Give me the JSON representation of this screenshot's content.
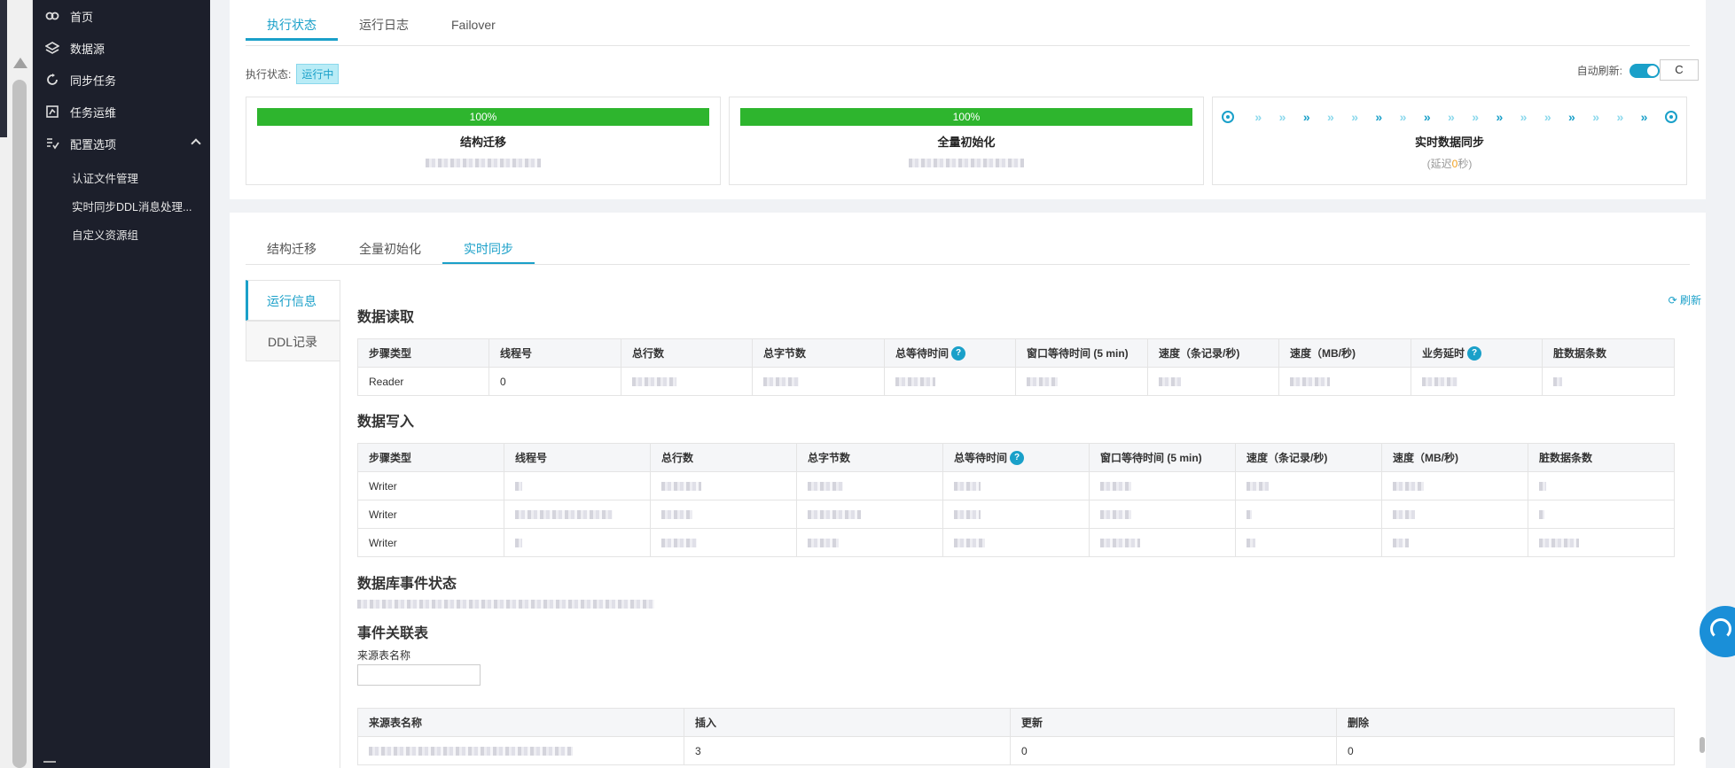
{
  "sidebar": {
    "items": [
      {
        "label": "首页",
        "icon": "home-icon"
      },
      {
        "label": "数据源",
        "icon": "layers-icon"
      },
      {
        "label": "同步任务",
        "icon": "sync-icon"
      },
      {
        "label": "任务运维",
        "icon": "ops-icon"
      },
      {
        "label": "配置选项",
        "icon": "config-icon"
      }
    ],
    "sub_items": [
      "认证文件管理",
      "实时同步DDL消息处理...",
      "自定义资源组"
    ]
  },
  "top_tabs": [
    "执行状态",
    "运行日志",
    "Failover"
  ],
  "status": {
    "label": "执行状态:",
    "value": "运行中"
  },
  "auto_refresh": {
    "label": "自动刷新:",
    "enabled": true,
    "button": "C"
  },
  "steps": [
    {
      "title": "结构迁移",
      "progress": "100%",
      "progress_value": 100
    },
    {
      "title": "全量初始化",
      "progress": "100%",
      "progress_value": 100
    },
    {
      "title": "实时数据同步",
      "delay_prefix": "(延迟",
      "delay_value": "0",
      "delay_suffix": "秒)"
    }
  ],
  "detail_tabs": [
    "结构迁移",
    "全量初始化",
    "实时同步"
  ],
  "side_tabs": [
    "运行信息",
    "DDL记录"
  ],
  "refresh_link": "刷新",
  "read_section": {
    "title": "数据读取",
    "headers": [
      "步骤类型",
      "线程号",
      "总行数",
      "总字节数",
      "总等待时间",
      "窗口等待时间 (5 min)",
      "速度（条记录/秒)",
      "速度（MB/秒)",
      "业务延时",
      "脏数据条数"
    ],
    "rows": [
      [
        "Reader",
        "0",
        "",
        "",
        "",
        "",
        "",
        "",
        "",
        ""
      ]
    ]
  },
  "write_section": {
    "title": "数据写入",
    "headers": [
      "步骤类型",
      "线程号",
      "总行数",
      "总字节数",
      "总等待时间",
      "窗口等待时间 (5 min)",
      "速度（条记录/秒)",
      "速度（MB/秒)",
      "脏数据条数"
    ],
    "rows": [
      [
        "Writer",
        "",
        "",
        "",
        "",
        "",
        "",
        "",
        ""
      ],
      [
        "Writer",
        "",
        "",
        "",
        "",
        "",
        "",
        "",
        ""
      ],
      [
        "Writer",
        "",
        "",
        "",
        "",
        "",
        "",
        "",
        ""
      ]
    ]
  },
  "db_event": {
    "title": "数据库事件状态"
  },
  "event_table": {
    "title": "事件关联表",
    "filter_label": "来源表名称",
    "headers": [
      "来源表名称",
      "插入",
      "更新",
      "删除"
    ],
    "rows": [
      [
        "",
        "3",
        "0",
        "0"
      ]
    ]
  }
}
